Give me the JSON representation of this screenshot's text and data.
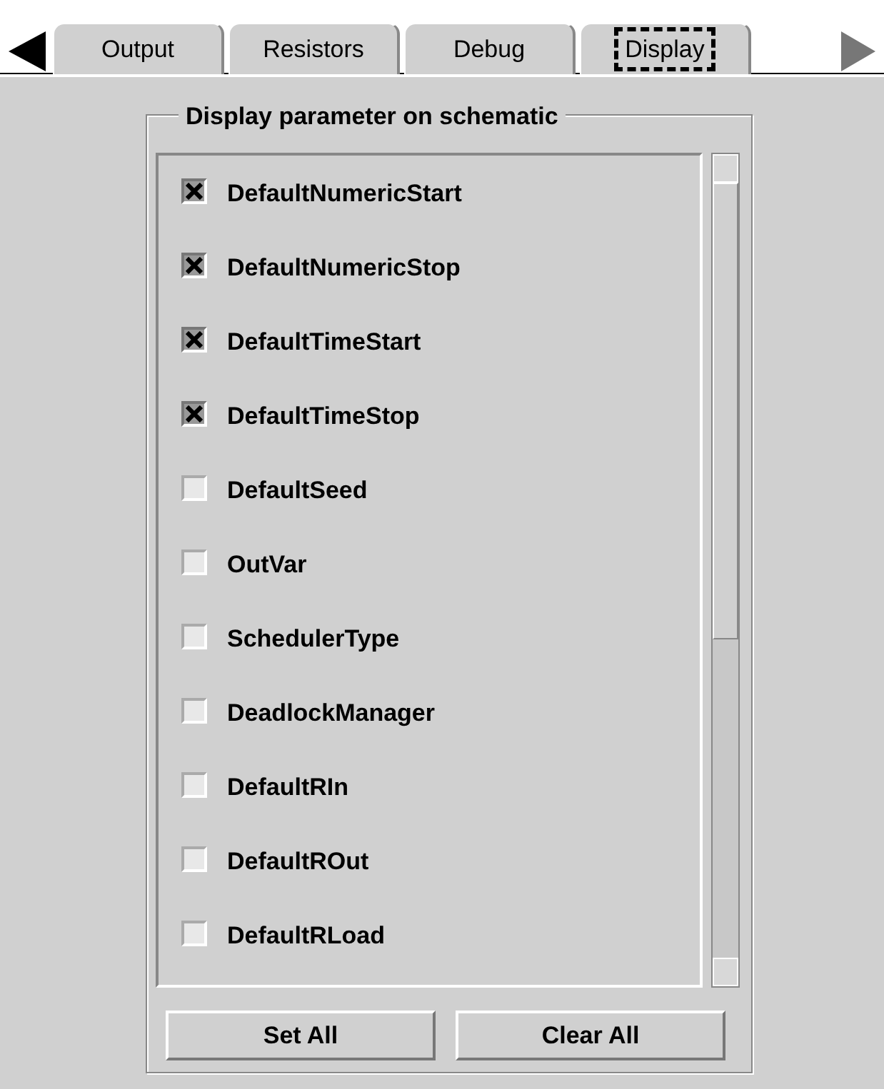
{
  "tabs": [
    {
      "label": "Output",
      "selected": false
    },
    {
      "label": "Resistors",
      "selected": false
    },
    {
      "label": "Debug",
      "selected": false
    },
    {
      "label": "Display",
      "selected": true
    }
  ],
  "group": {
    "title": "Display parameter on schematic",
    "items": [
      {
        "label": "DefaultNumericStart",
        "checked": true
      },
      {
        "label": "DefaultNumericStop",
        "checked": true
      },
      {
        "label": "DefaultTimeStart",
        "checked": true
      },
      {
        "label": "DefaultTimeStop",
        "checked": true
      },
      {
        "label": "DefaultSeed",
        "checked": false
      },
      {
        "label": "OutVar",
        "checked": false
      },
      {
        "label": "SchedulerType",
        "checked": false
      },
      {
        "label": "DeadlockManager",
        "checked": false
      },
      {
        "label": "DefaultRIn",
        "checked": false
      },
      {
        "label": "DefaultROut",
        "checked": false
      },
      {
        "label": "DefaultRLoad",
        "checked": false
      }
    ]
  },
  "buttons": [
    "Set All",
    "Clear All"
  ]
}
